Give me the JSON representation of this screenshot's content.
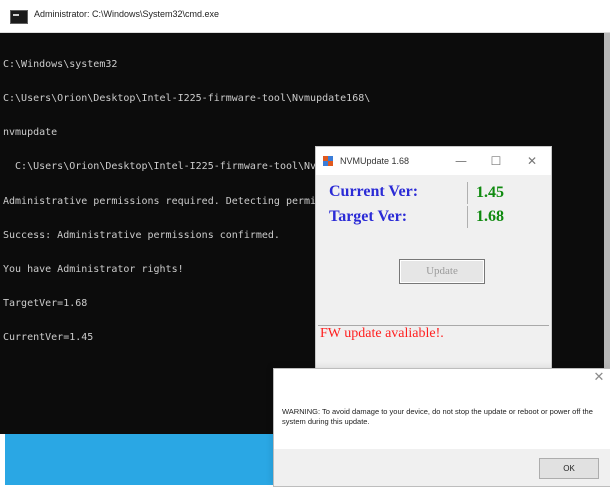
{
  "cmd": {
    "title": "Administrator: C:\\Windows\\System32\\cmd.exe",
    "lines": [
      "C:\\Windows\\system32",
      "C:\\Users\\Orion\\Desktop\\Intel-I225-firmware-tool\\Nvmupdate168\\",
      "nvmupdate",
      "  C:\\Users\\Orion\\Desktop\\Intel-I225-firmware-tool\\Nvmupdate168\\nvmupdate",
      "Administrative permissions required. Detecting permissions...",
      "Success: Administrative permissions confirmed.",
      "You have Administrator rights!",
      "TargetVer=1.68",
      "CurrentVer=1.45"
    ]
  },
  "nvm": {
    "title": "NVMUpdate 1.68",
    "minimize": "—",
    "maximize": "☐",
    "close": "✕",
    "current_label": "Current Ver:",
    "current_value": "1.45",
    "target_label": "Target Ver:",
    "target_value": "1.68",
    "update_button": "Update",
    "status": "FW update avaliable!."
  },
  "warning": {
    "close": "✕",
    "message": "WARNING: To avoid damage to your device, do not stop the update or reboot or power off the system during this update.",
    "ok_button": "OK"
  },
  "colors": {
    "console_bg": "#0c0c0c",
    "console_text": "#cccccc",
    "label_blue": "#2b2bd6",
    "value_green": "#0f8a0f",
    "status_red": "#ff1f1f",
    "desktop_blue": "#2aa7e4"
  }
}
